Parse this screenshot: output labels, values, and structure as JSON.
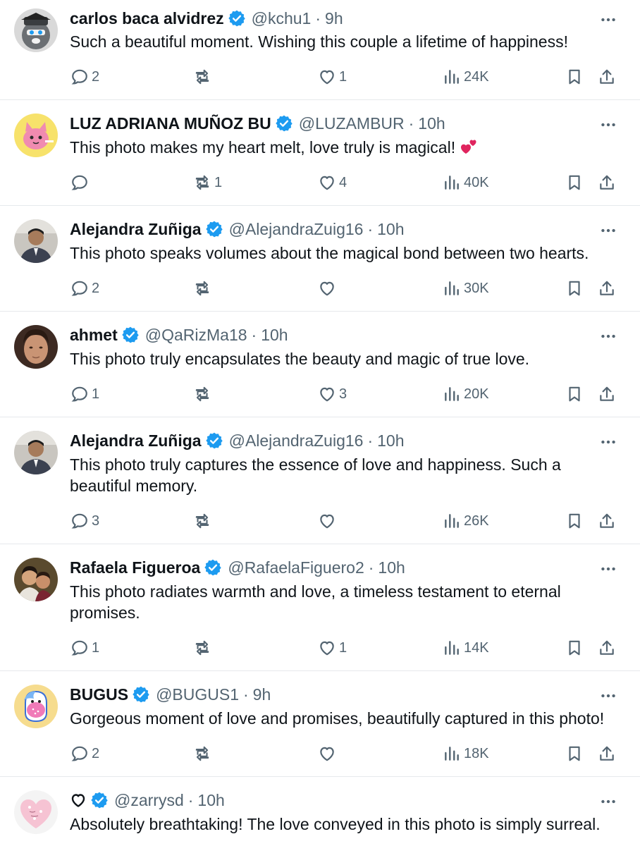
{
  "colors": {
    "text": "#0f1419",
    "muted": "#536471",
    "verified": "#1d9bf0",
    "divider": "#e6e9ec",
    "heart_emoji": "#e0245e"
  },
  "posts": [
    {
      "name": "carlos baca alvidrez",
      "handle": "@kchu1",
      "sep": "·",
      "time": "9h",
      "text": "Such a beautiful moment. Wishing this couple a lifetime of happiness!",
      "emoji": null,
      "replies": "2",
      "reposts": "",
      "likes": "1",
      "views": "24K",
      "avatar_icon": "raccoon-avatar-icon"
    },
    {
      "name": "LUZ ADRIANA MUÑOZ BU",
      "handle": "@LUZAMBUR",
      "sep": "·",
      "time": "10h",
      "text": "This photo makes my heart melt, love truly is magical!",
      "emoji": "two-hearts-emoji",
      "replies": "",
      "reposts": "1",
      "likes": "4",
      "views": "40K",
      "avatar_icon": "pink-cat-avatar-icon"
    },
    {
      "name": "Alejandra Zuñiga",
      "handle": "@AlejandraZuig16",
      "sep": "·",
      "time": "10h",
      "text": "This photo speaks volumes about the magical bond between two hearts.",
      "emoji": null,
      "replies": "2",
      "reposts": "",
      "likes": "",
      "views": "30K",
      "avatar_icon": "man-portrait-avatar-icon"
    },
    {
      "name": "ahmet",
      "handle": "@QaRizMa18",
      "sep": "·",
      "time": "10h",
      "text": "This photo truly encapsulates the beauty and magic of true love.",
      "emoji": null,
      "replies": "1",
      "reposts": "",
      "likes": "3",
      "views": "20K",
      "avatar_icon": "man-face-avatar-icon"
    },
    {
      "name": "Alejandra Zuñiga",
      "handle": "@AlejandraZuig16",
      "sep": "·",
      "time": "10h",
      "text": "This photo truly captures the essence of love and happiness. Such a beautiful memory.",
      "emoji": null,
      "replies": "3",
      "reposts": "",
      "likes": "",
      "views": "26K",
      "avatar_icon": "man-portrait-avatar-icon"
    },
    {
      "name": "Rafaela Figueroa",
      "handle": "@RafaelaFiguero2",
      "sep": "·",
      "time": "10h",
      "text": "This photo radiates warmth and love, a timeless testament to eternal promises.",
      "emoji": null,
      "replies": "1",
      "reposts": "",
      "likes": "1",
      "views": "14K",
      "avatar_icon": "couple-photo-avatar-icon"
    },
    {
      "name": "BUGUS",
      "handle": "@BUGUS1",
      "sep": "·",
      "time": "9h",
      "text": "Gorgeous moment of love and promises, beautifully captured in this photo!",
      "emoji": null,
      "replies": "2",
      "reposts": "",
      "likes": "",
      "views": "18K",
      "avatar_icon": "cartoon-face-avatar-icon"
    },
    {
      "name": "",
      "name_icon": "heart-outline-icon",
      "handle": "@zarrysd",
      "sep": "·",
      "time": "10h",
      "text": "Absolutely breathtaking! The love conveyed in this photo is simply surreal.",
      "emoji": null,
      "replies": "",
      "reposts": "",
      "likes": "",
      "views": "",
      "avatar_icon": "candy-heart-avatar-icon"
    }
  ]
}
